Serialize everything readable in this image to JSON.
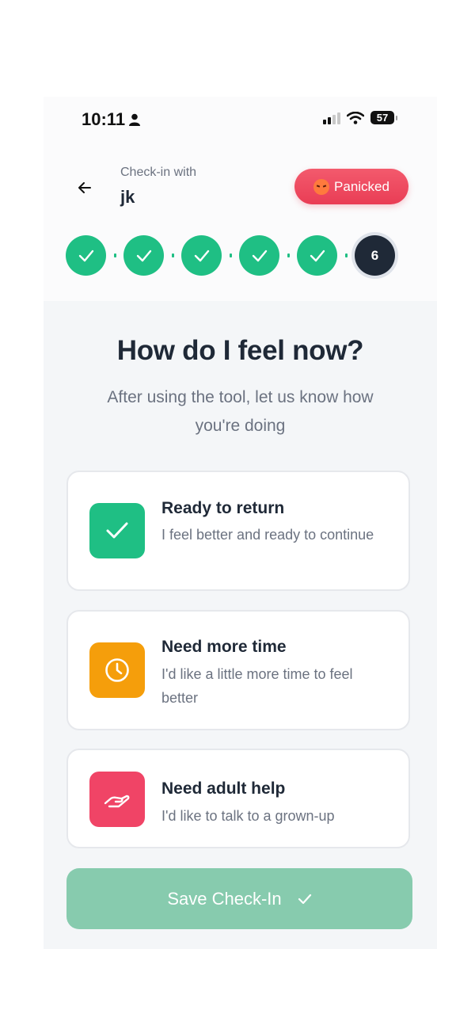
{
  "status_bar": {
    "time": "10:11",
    "battery": "57"
  },
  "header": {
    "checkin_label": "Check-in with",
    "name": "jk",
    "mood": "Panicked"
  },
  "steps": {
    "current_label": "6",
    "completed": 5
  },
  "main": {
    "title": "How do I feel now?",
    "subtitle": "After using the tool, let us know how you're doing"
  },
  "options": [
    {
      "title": "Ready to return",
      "description": "I feel better and ready to continue",
      "icon": "check-icon",
      "color": "#1fbf84"
    },
    {
      "title": "Need more time",
      "description": "I'd like a little more time to feel better",
      "icon": "clock-icon",
      "color": "#f59e0b"
    },
    {
      "title": "Need adult help",
      "description": "I'd like to talk to a grown-up",
      "icon": "helping-hand-icon",
      "color": "#f04466"
    }
  ],
  "save_button": {
    "label": "Save Check-In"
  }
}
